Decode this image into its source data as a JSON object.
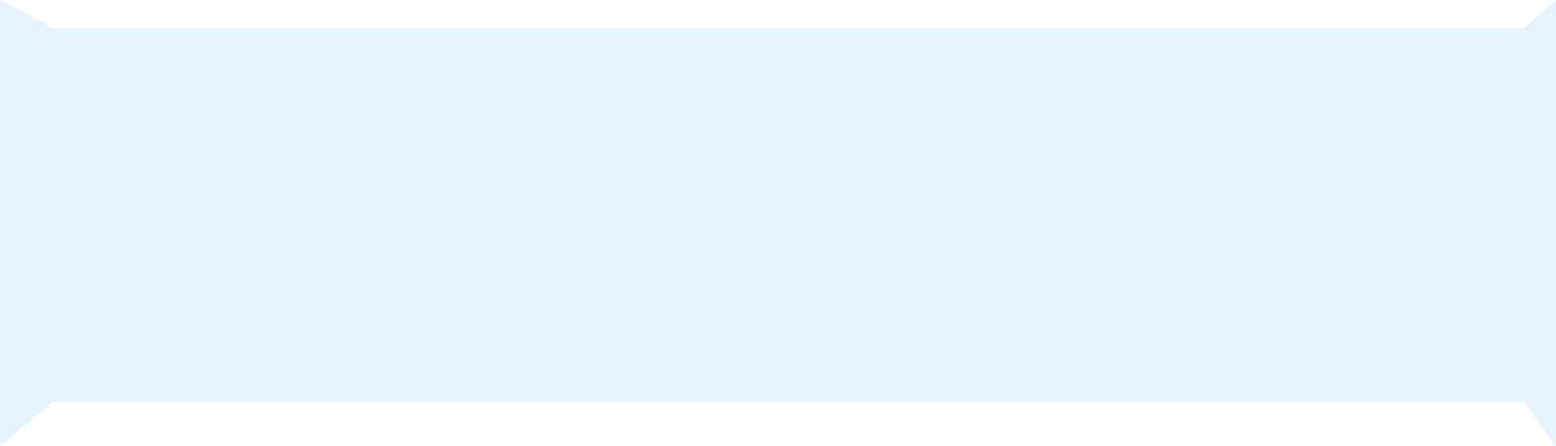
{
  "banner": {
    "fill_color": "#E5F3FE",
    "background_color": "#FFFFFF"
  }
}
